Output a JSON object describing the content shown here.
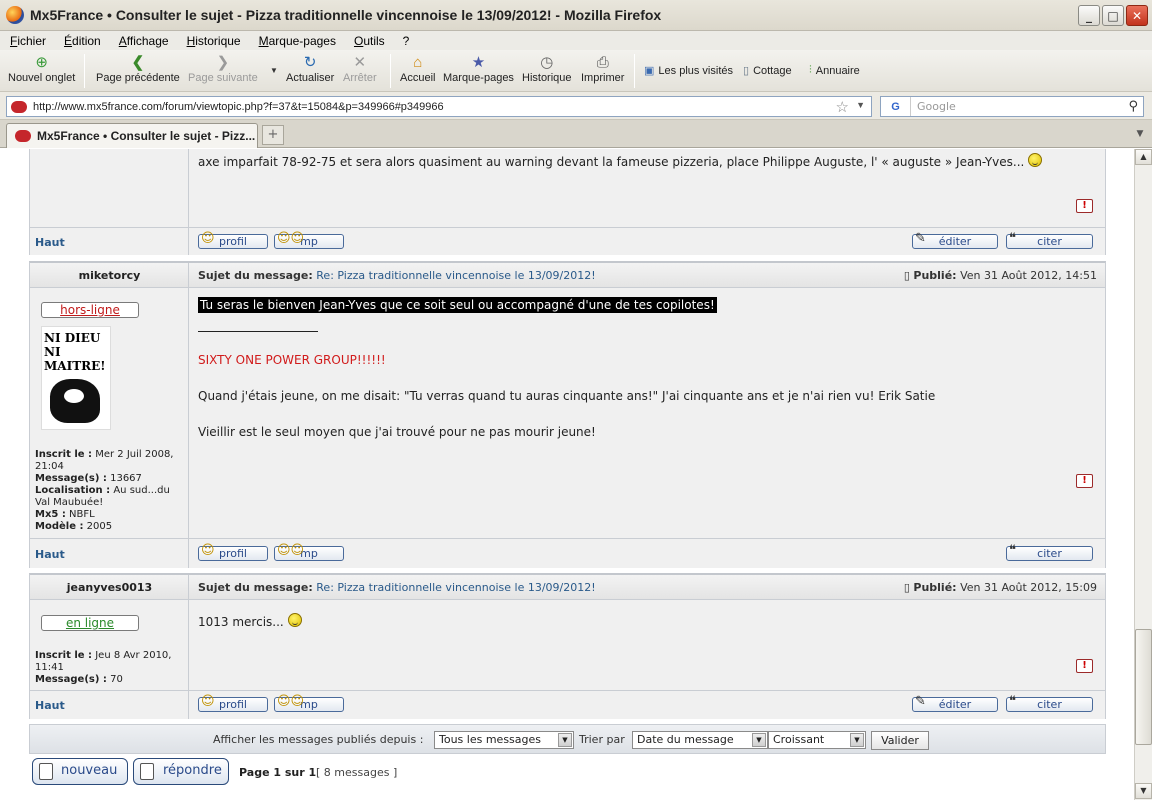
{
  "window": {
    "title": "Mx5France • Consulter le sujet - Pizza traditionnelle vincennoise le 13/09/2012! - Mozilla Firefox"
  },
  "menu": [
    "Fichier",
    "Édition",
    "Affichage",
    "Historique",
    "Marque-pages",
    "Outils",
    "?"
  ],
  "nav": {
    "new_tab": "Nouvel onglet",
    "back": "Page précédente",
    "forward": "Page suivante",
    "reload": "Actualiser",
    "stop": "Arrêter",
    "home": "Accueil",
    "bookmarks": "Marque-pages",
    "history": "Historique",
    "print": "Imprimer",
    "bm_most_visited": "Les plus visités",
    "bm_cottage": "Cottage",
    "bm_annuaire": "Annuaire"
  },
  "urlbar": {
    "url": "http://www.mx5france.com/forum/viewtopic.php?f=37&t=15084&p=349966#p349966",
    "search_placeholder": "Google"
  },
  "tab": {
    "label": "Mx5France • Consulter le sujet - Pizz..."
  },
  "post0": {
    "text": "axe imparfait 78-92-75 et sera alors quasiment au warning devant la fameuse pizzeria, place Philippe Auguste, l' « auguste » Jean-Yves...",
    "top": "Haut",
    "profile": "profil",
    "pm": "mp",
    "edit": "éditer",
    "quote": "citer"
  },
  "post1": {
    "author": "miketorcy",
    "subject_label": "Sujet du message:",
    "subject": "Re: Pizza traditionnelle vincennoise le 13/09/2012!",
    "published_label": "Publié:",
    "published": "Ven 31 Août 2012, 14:51",
    "status": "hors-ligne",
    "avatar_text": "NI DIEU NI MAITRE!",
    "info": {
      "joined_label": "Inscrit le :",
      "joined": "Mer 2 Juil 2008, 21:04",
      "messages_label": "Message(s) :",
      "messages": "13667",
      "location_label": "Localisation :",
      "location": "Au sud...du Val Maubuée!",
      "mx5_label": "Mx5 :",
      "mx5": "NBFL",
      "model_label": "Modèle :",
      "model": "2005"
    },
    "highlight": "Tu seras le bienven Jean-Yves que ce soit seul ou accompagné d'une de tes copilotes!",
    "sig_separator": "_________________",
    "sig1": "SIXTY ONE POWER GROUP!!!!!!",
    "sig2": "Quand j'étais jeune, on me disait: \"Tu verras quand tu auras cinquante ans!\" J'ai cinquante ans et je n'ai rien vu! Erik Satie",
    "sig3": "Vieillir est le seul moyen que j'ai trouvé pour ne pas mourir jeune!",
    "top": "Haut",
    "profile": "profil",
    "pm": "mp",
    "quote": "citer"
  },
  "post2": {
    "author": "jeanyves0013",
    "subject_label": "Sujet du message:",
    "subject": "Re: Pizza traditionnelle vincennoise le 13/09/2012!",
    "published_label": "Publié:",
    "published": "Ven 31 Août 2012, 15:09",
    "status": "en ligne",
    "info": {
      "joined_label": "Inscrit le :",
      "joined": "Jeu 8 Avr 2010, 11:41",
      "messages_label": "Message(s) :",
      "messages": "70"
    },
    "text": "1013 mercis...",
    "top": "Haut",
    "profile": "profil",
    "pm": "mp",
    "edit": "éditer",
    "quote": "citer"
  },
  "footer": {
    "filter_label": "Afficher les messages publiés depuis :",
    "filter_value": "Tous les messages",
    "sort_label": "Trier par",
    "sort_value": "Date du message",
    "order_value": "Croissant",
    "submit": "Valider",
    "new_topic": "nouveau",
    "reply": "répondre",
    "page_info": "Page 1 sur 1",
    "count": "[ 8 messages ]"
  },
  "colors": {
    "link": "#2a5a8a",
    "signature": "#d11b1b",
    "online": "#2a8a2a",
    "offline": "#c01a1a"
  }
}
